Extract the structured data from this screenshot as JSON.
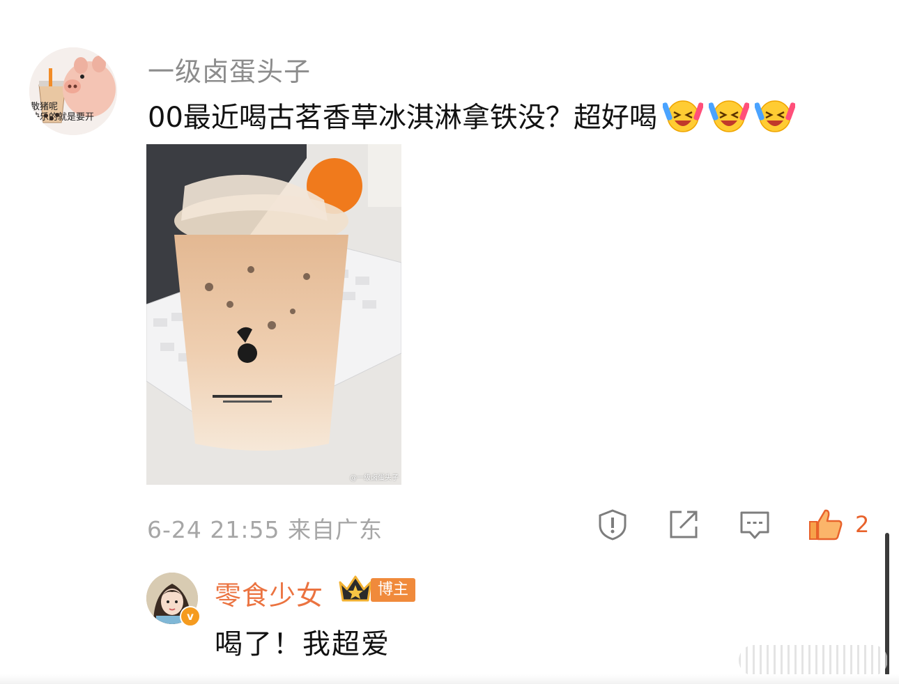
{
  "comment": {
    "avatar_text": "散猪呢 \n快乐的就是要开",
    "username": "一级卤蛋头子",
    "text": "00最近喝古茗香草冰淇淋拿铁没？超好喝",
    "emoji_icons": [
      "laugh-cry-emoji",
      "laugh-cry-emoji",
      "laugh-cry-emoji"
    ],
    "image_watermark": "@一级卤蛋头子",
    "timestamp": "6-24 21:55",
    "location": "来自广东",
    "actions": {
      "report_icon": "shield-exclamation-icon",
      "share_icon": "share-icon",
      "reply_icon": "comment-icon",
      "like_icon": "thumbs-up-icon",
      "like_count": "2"
    }
  },
  "reply": {
    "username": "零食少女",
    "badge": "博主",
    "text": "喝了！我超爱"
  },
  "colors": {
    "accent": "#eb7340",
    "muted": "#a6a6a6",
    "like": "#e8622b"
  }
}
